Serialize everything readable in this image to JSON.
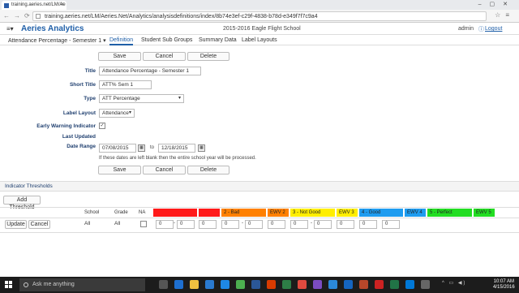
{
  "browser": {
    "tab_title": "training.aeries.net/LM/Ae",
    "url": "training.aeries.net/LM/Aeries.Net/Analytics/analysisdefinitions/index/8b74e3ef-c29f-4838-b78d-e349f7f7c9a4"
  },
  "app": {
    "title": "Aeries Analytics",
    "school": "2015-2016 Eagle Flight School",
    "user": "admin",
    "logout": "Logout"
  },
  "subnav": {
    "analysis": "Attendance Percentage - Semester 1",
    "tabs": [
      "Definition",
      "Student Sub Groups",
      "Summary Data",
      "Label Layouts"
    ]
  },
  "actions": {
    "save": "Save",
    "cancel": "Cancel",
    "delete": "Delete"
  },
  "form": {
    "title_label": "Title",
    "title_value": "Attendance Percentage - Semester 1",
    "short_title_label": "Short Title",
    "short_title_value": "ATT% Sem 1",
    "type_label": "Type",
    "type_value": "ATT Percentage",
    "label_layout_label": "Label Layout",
    "label_layout_value": "Attendance",
    "ewi_label": "Early Warning Indicator",
    "last_updated_label": "Last Updated",
    "date_range_label": "Date Range",
    "date_from": "07/08/2015",
    "date_to_word": "to",
    "date_to": "12/18/2015",
    "date_note": "If these dates are left blank then the entire school year will be processed."
  },
  "thresholds": {
    "section_title": "Indicator Thresholds",
    "add_button": "Add Threshold",
    "columns": {
      "school": "School",
      "grade": "Grade",
      "na": "NA"
    },
    "levels": [
      {
        "label": "",
        "color": "#ff1a1a"
      },
      {
        "label": "",
        "color": "#ff1a1a"
      },
      {
        "label": "2 - Bad",
        "color": "#ff8000"
      },
      {
        "label": "EWV 2",
        "color": "#ff8000"
      },
      {
        "label": "3 - Not Good",
        "color": "#ffee00"
      },
      {
        "label": "EWV 3",
        "color": "#ffee00"
      },
      {
        "label": "4 - Good",
        "color": "#1e9cf0"
      },
      {
        "label": "EWV 4",
        "color": "#1e9cf0"
      },
      {
        "label": "5 - Perfect",
        "color": "#22dd22"
      },
      {
        "label": "EWV 5",
        "color": "#22dd22"
      }
    ],
    "row": {
      "update": "Update",
      "cancel": "Cancel",
      "school": "All",
      "grade": "All",
      "values": [
        "0",
        "0",
        "0",
        "0",
        "0",
        "0",
        "0",
        "0",
        "0",
        "0",
        "0"
      ]
    }
  },
  "taskbar": {
    "search_placeholder": "Ask me anything",
    "time": "10:07 AM",
    "date": "4/15/2016"
  }
}
